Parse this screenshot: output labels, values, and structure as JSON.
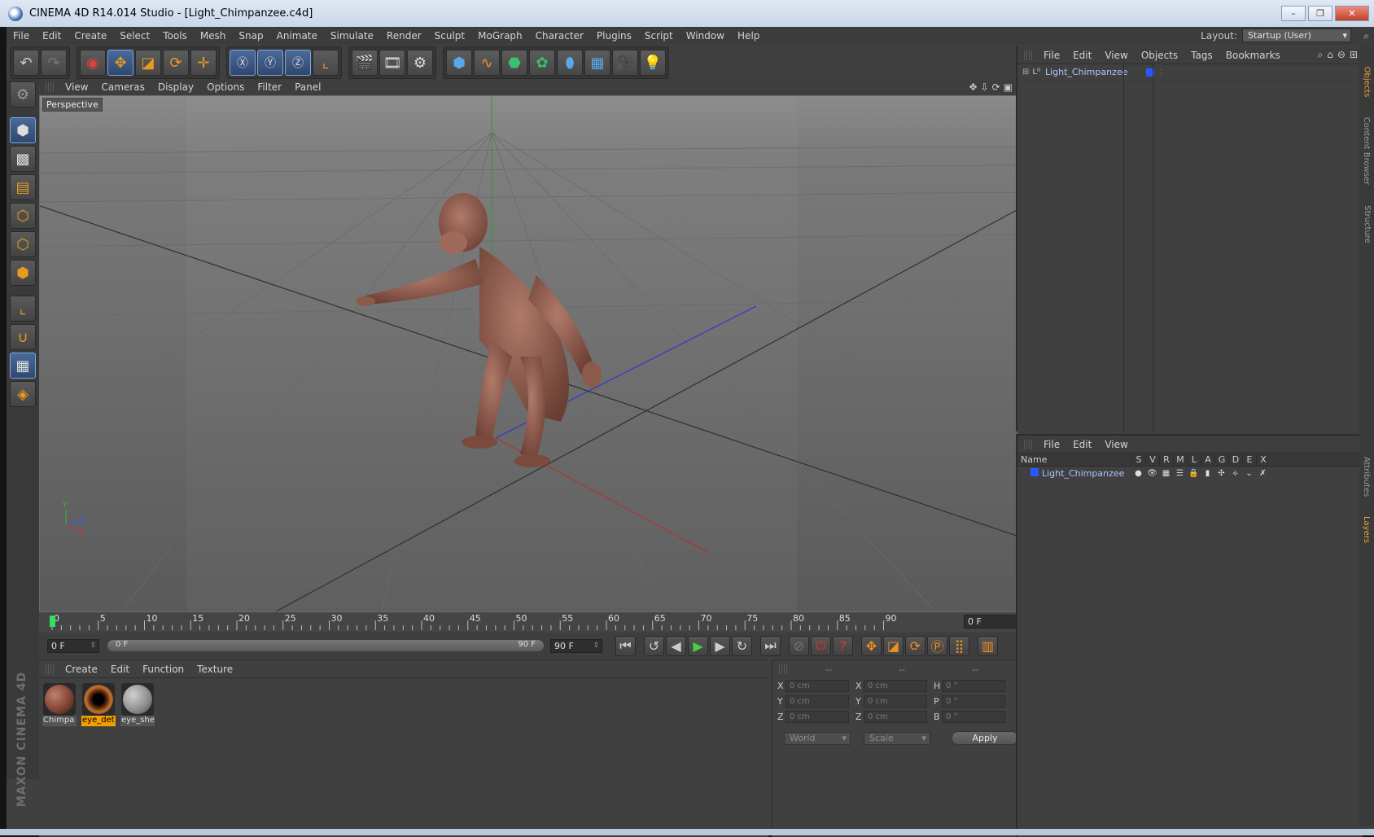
{
  "window": {
    "title": "CINEMA 4D R14.014 Studio - [Light_Chimpanzee.c4d]",
    "min": "–",
    "max": "❐",
    "close": "✕"
  },
  "menu": [
    "File",
    "Edit",
    "Create",
    "Select",
    "Tools",
    "Mesh",
    "Snap",
    "Animate",
    "Simulate",
    "Render",
    "Sculpt",
    "MoGraph",
    "Character",
    "Plugins",
    "Script",
    "Window",
    "Help"
  ],
  "layout": {
    "label": "Layout:",
    "value": "Startup (User)"
  },
  "viewport": {
    "menu": [
      "View",
      "Cameras",
      "Display",
      "Options",
      "Filter",
      "Panel"
    ],
    "label": "Perspective",
    "axis_y": "Y",
    "axis_x": "X",
    "axis_z": "Z"
  },
  "timeline": {
    "ticks": [
      "0",
      "5",
      "10",
      "15",
      "20",
      "25",
      "30",
      "35",
      "40",
      "45",
      "50",
      "55",
      "60",
      "65",
      "70",
      "75",
      "80",
      "85",
      "90"
    ],
    "current_frame": "0 F"
  },
  "transport": {
    "start": "0 F",
    "range_start": "0 F",
    "range_end": "90 F",
    "end": "90 F"
  },
  "materials": {
    "menu": [
      "Create",
      "Edit",
      "Function",
      "Texture"
    ],
    "items": [
      {
        "name": "Chimpa",
        "color": "#8a4a3a"
      },
      {
        "name": "eye_det",
        "color": "#5a2a12"
      },
      {
        "name": "eye_she",
        "color": "#8a8a8a"
      }
    ]
  },
  "coords": {
    "headers": [
      "--",
      "--",
      "--"
    ],
    "rows": [
      {
        "a1": "X",
        "v1": "0 cm",
        "a2": "X",
        "v2": "0 cm",
        "a3": "H",
        "v3": "0 °"
      },
      {
        "a1": "Y",
        "v1": "0 cm",
        "a2": "Y",
        "v2": "0 cm",
        "a3": "P",
        "v3": "0 °"
      },
      {
        "a1": "Z",
        "v1": "0 cm",
        "a2": "Z",
        "v2": "0 cm",
        "a3": "B",
        "v3": "0 °"
      }
    ],
    "space": "World",
    "mode": "Scale",
    "apply": "Apply"
  },
  "objects": {
    "menu": [
      "File",
      "Edit",
      "View",
      "Objects",
      "Tags",
      "Bookmarks"
    ],
    "items": [
      {
        "name": "Light_Chimpanzee"
      }
    ]
  },
  "layers": {
    "menu": [
      "File",
      "Edit",
      "View"
    ],
    "columns": [
      "Name",
      "S",
      "V",
      "R",
      "M",
      "L",
      "A",
      "G",
      "D",
      "E",
      "X"
    ],
    "rows": [
      {
        "name": "Light_Chimpanzee"
      }
    ]
  },
  "sidetabs": [
    "Objects",
    "Content Browser",
    "Structure",
    "Attributes",
    "Layers"
  ],
  "branding": "MAXON CINEMA 4D",
  "colors": {
    "accent": "#e89a20",
    "selection": "#f0a000",
    "layer_blue": "#2a58ff"
  }
}
